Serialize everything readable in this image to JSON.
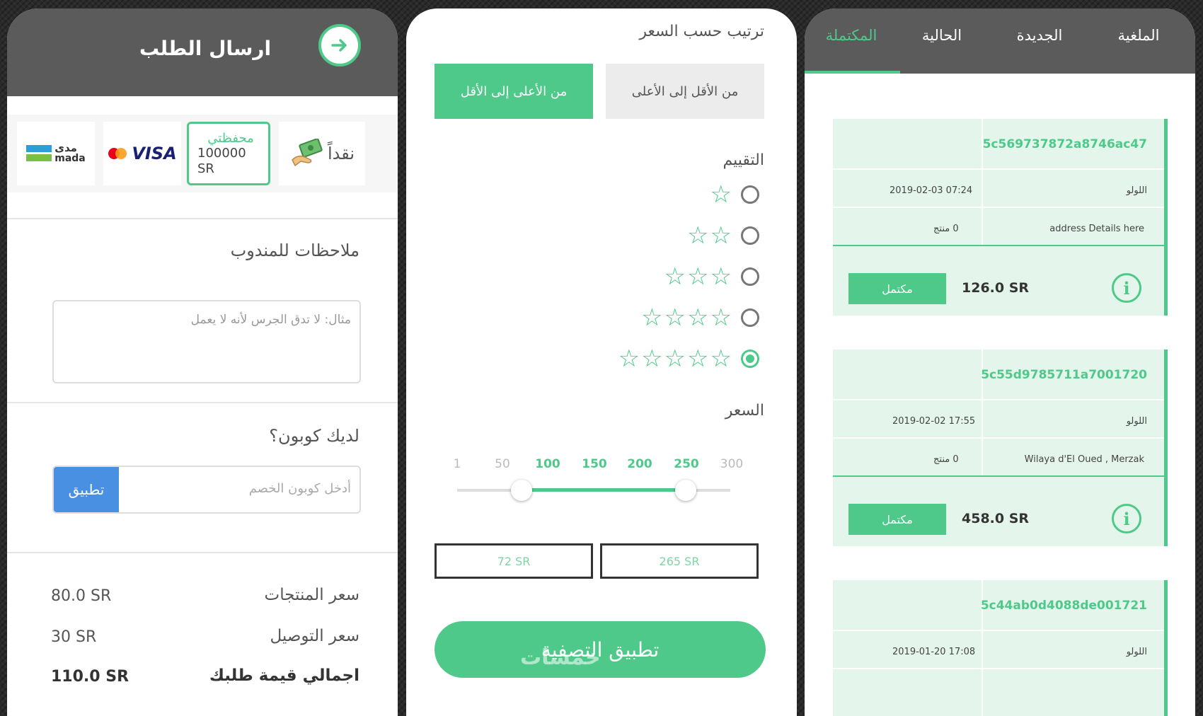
{
  "checkout": {
    "title": "ارسال الطلب",
    "payment": {
      "cash_label": "نقداً",
      "wallet_title": "محفظتي",
      "wallet_amount": "100000",
      "wallet_currency": "SR",
      "visa_label": "VISA",
      "mada_ar": "مدى",
      "mada_en": "mada"
    },
    "notes_title": "ملاحظات للمندوب",
    "notes_placeholder": "مثال: لا تدق الجرس لأنه لا يعمل",
    "coupon_title": "لديك كوبون؟",
    "coupon_placeholder": "أدخل كوبون الخصم",
    "coupon_apply": "تطبيق",
    "summary": [
      {
        "label": "سعر المنتجات",
        "value": "80.0  SR"
      },
      {
        "label": "سعر التوصيل",
        "value": "30  SR"
      },
      {
        "label": "اجمالي قيمة طلبك",
        "value": "110.0  SR"
      }
    ]
  },
  "filter": {
    "sort_title": "ترتيب حسب السعر",
    "sort_high_low": "من الأعلى إلى الأقل",
    "sort_low_high": "من الأقل إلى الأعلى",
    "rating_title": "التقييم",
    "ratings": [
      {
        "stars": "☆",
        "selected": false
      },
      {
        "stars": "☆☆",
        "selected": false
      },
      {
        "stars": "☆☆☆",
        "selected": false
      },
      {
        "stars": "☆☆☆☆",
        "selected": false
      },
      {
        "stars": "☆☆☆☆☆",
        "selected": true
      }
    ],
    "price_title": "السعر",
    "price_ticks": [
      "1",
      "50",
      "100",
      "150",
      "200",
      "250",
      "300"
    ],
    "price_min": "72 SR",
    "price_max": "265 SR",
    "apply_button": "تطبيق التصفية"
  },
  "orders": {
    "tabs": [
      "الملغية",
      "الجديدة",
      "الحالية",
      "المكتملة"
    ],
    "active_tab": "المكتملة",
    "cards": [
      {
        "id": "5c569737872a8746ac47",
        "store": "اللولو",
        "date": "2019-02-03 07:24",
        "address": "address Details  here",
        "products": "0  منتج",
        "total": "126.0 SR",
        "status": "مكتمل"
      },
      {
        "id": "5c55d9785711a7001720",
        "store": "اللولو",
        "date": "2019-02-02 17:55",
        "address": "Wilaya d'El Oued , Merzak",
        "products": "0  منتج",
        "total": "458.0 SR",
        "status": "مكتمل"
      },
      {
        "id": "5c44ab0d4088de001721",
        "store": "اللولو",
        "date": "2019-01-20 17:08"
      }
    ]
  },
  "watermark": "خمسات",
  "colors": {
    "accent": "#4fc98a",
    "header": "#5b5b5b",
    "coupon_button": "#4a90e2"
  }
}
